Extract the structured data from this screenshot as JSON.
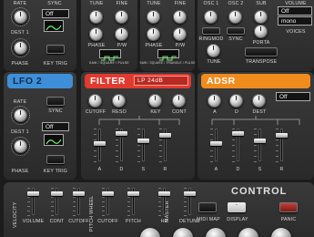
{
  "lfo1": {
    "labels": {
      "rate": "RATE",
      "sync": "SYNC",
      "dest": "DEST 1",
      "phase": "PHASE",
      "key_trig": "KEY TRIG"
    },
    "dest_value": "Off"
  },
  "osc_a": {
    "labels": {
      "tune": "TUNE",
      "fine": "FINE",
      "phase": "PHASE",
      "pw": "P/W",
      "wave": "SAW / SQUARE / PULSE"
    }
  },
  "osc_b": {
    "labels": {
      "tune": "TUNE",
      "fine": "FINE",
      "phase": "PHASE",
      "pw": "P/W",
      "wave": "SAW / SQUARE / TRIANGLE / PULSE"
    }
  },
  "osc_mix": {
    "labels": {
      "osc1": "OSC 1",
      "osc2": "OSC 2",
      "sub": "SUB",
      "ringmod": "RINGMOD",
      "sync": "SYNC",
      "porta": "PORTA",
      "tune": "TUNE",
      "transpose": "TRANSPOSE"
    }
  },
  "master": {
    "labels": {
      "volume": "VOLUME",
      "voices": "VOICES"
    },
    "off_value": "Off",
    "mode_value": "mono"
  },
  "lfo2": {
    "title": "LFO 2",
    "labels": {
      "rate": "RATE",
      "sync": "SYNC",
      "dest": "DEST 1",
      "phase": "PHASE",
      "key_trig": "KEY TRIG"
    },
    "dest_value": "Off"
  },
  "filter": {
    "title": "FILTER",
    "type_value": "LP 24dB",
    "labels": {
      "cutoff": "CUTOFF",
      "reso": "RESO",
      "key": "KEY",
      "cont": "CONT"
    },
    "adsr_labels": [
      "A",
      "D",
      "S",
      "R"
    ]
  },
  "adsr": {
    "title": "ADSR",
    "dest_value": "Off",
    "labels": {
      "a": "A",
      "d": "D",
      "dest": "DEST"
    },
    "fader_labels": [
      "A",
      "D",
      "S",
      "R"
    ]
  },
  "control": {
    "title": "CONTROL",
    "velocity": "VELOCITY",
    "pitch_wheel": "PITCH WHEEL",
    "master": "MASTER",
    "labels": [
      "VOLUME",
      "CONT",
      "CUTOFF",
      "CUTOFF",
      "PITCH",
      "HP",
      "DETUNE"
    ],
    "midi_map": "MIDI MAP",
    "display": "DISPLAY",
    "panic": "PANIC",
    "display_value": "-"
  },
  "colors": {
    "lfo2": "#3f8fd8",
    "filter": "#e23a2f",
    "adsr": "#f08c1e",
    "control": "#d8d8d8"
  }
}
